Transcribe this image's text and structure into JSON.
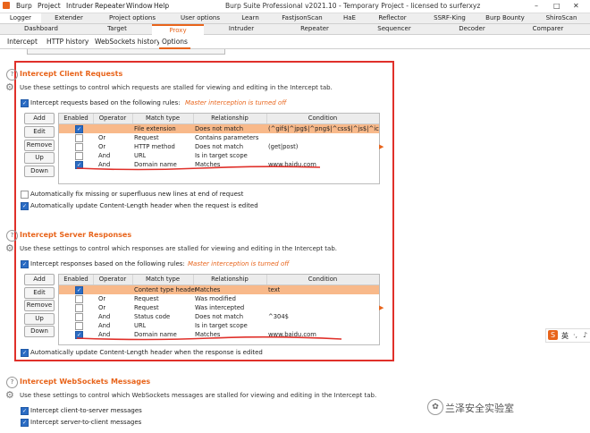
{
  "menubar": {
    "items": [
      "Burp",
      "Project",
      "Intruder",
      "Repeater",
      "Window",
      "Help"
    ],
    "title": "Burp Suite Professional v2021.10 - Temporary Project - licensed to surferxyz"
  },
  "tabs_row1": [
    "Logger",
    "Extender",
    "Project options",
    "User options",
    "Learn",
    "FastjsonScan",
    "HaE",
    "Reflector",
    "SSRF-King",
    "Burp Bounty",
    "ShiroScan"
  ],
  "tabs_row2": [
    "Dashboard",
    "Target",
    "Proxy",
    "Intruder",
    "Repeater",
    "Sequencer",
    "Decoder",
    "Comparer"
  ],
  "subtabs": [
    "Intercept",
    "HTTP history",
    "WebSockets history",
    "Options"
  ],
  "client": {
    "title": "Intercept Client Requests",
    "desc": "Use these settings to control which requests are stalled for viewing and editing in the Intercept tab.",
    "rule_label": "Intercept requests based on the following rules:",
    "master_note": "Master interception is turned off",
    "buttons": [
      "Add",
      "Edit",
      "Remove",
      "Up",
      "Down"
    ],
    "headers": [
      "Enabled",
      "Operator",
      "Match type",
      "Relationship",
      "Condition"
    ],
    "rows": [
      {
        "enabled": true,
        "operator": "",
        "match": "File extension",
        "rel": "Does not match",
        "cond": "(^gif$|^jpg$|^png$|^css$|^js$|^ico$|^..."
      },
      {
        "enabled": false,
        "operator": "Or",
        "match": "Request",
        "rel": "Contains parameters",
        "cond": ""
      },
      {
        "enabled": false,
        "operator": "Or",
        "match": "HTTP method",
        "rel": "Does not match",
        "cond": "(get|post)"
      },
      {
        "enabled": false,
        "operator": "And",
        "match": "URL",
        "rel": "Is in target scope",
        "cond": ""
      },
      {
        "enabled": true,
        "operator": "And",
        "match": "Domain name",
        "rel": "Matches",
        "cond": "www.baidu.com"
      }
    ],
    "fix_newlines": "Automatically fix missing or superfluous new lines at end of request",
    "update_length": "Automatically update Content-Length header when the request is edited"
  },
  "server": {
    "title": "Intercept Server Responses",
    "desc": "Use these settings to control which responses are stalled for viewing and editing in the Intercept tab.",
    "rule_label": "Intercept responses based on the following rules:",
    "master_note": "Master interception is turned off",
    "buttons": [
      "Add",
      "Edit",
      "Remove",
      "Up",
      "Down"
    ],
    "headers": [
      "Enabled",
      "Operator",
      "Match type",
      "Relationship",
      "Condition"
    ],
    "rows": [
      {
        "enabled": true,
        "operator": "",
        "match": "Content type header",
        "rel": "Matches",
        "cond": "text"
      },
      {
        "enabled": false,
        "operator": "Or",
        "match": "Request",
        "rel": "Was modified",
        "cond": ""
      },
      {
        "enabled": false,
        "operator": "Or",
        "match": "Request",
        "rel": "Was intercepted",
        "cond": ""
      },
      {
        "enabled": false,
        "operator": "And",
        "match": "Status code",
        "rel": "Does not match",
        "cond": "^304$"
      },
      {
        "enabled": false,
        "operator": "And",
        "match": "URL",
        "rel": "Is in target scope",
        "cond": ""
      },
      {
        "enabled": true,
        "operator": "And",
        "match": "Domain name",
        "rel": "Matches",
        "cond": "www.baidu.com"
      }
    ],
    "update_length": "Automatically update Content-Length header when the response is edited"
  },
  "websockets": {
    "title": "Intercept WebSockets Messages",
    "desc": "Use these settings to control which WebSockets messages are stalled for viewing and editing in the Intercept tab.",
    "client_to_server": "Intercept client-to-server messages",
    "server_to_client": "Intercept server-to-client messages"
  },
  "watermark": "兰泽安全实验室",
  "ime_label": "英",
  "colors": {
    "accent": "#e8641b",
    "highlight_box": "#e0302a",
    "row_selected": "#f8b98a",
    "checkbox": "#2b6cc4"
  }
}
